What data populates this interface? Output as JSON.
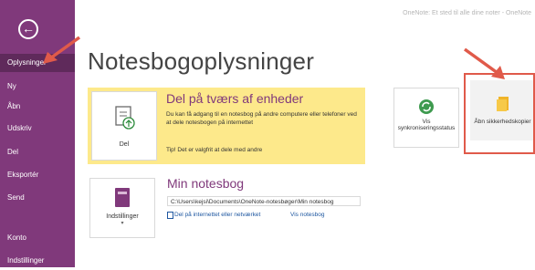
{
  "window": {
    "hint": "OneNote: Et sted til alle dine noter - OneNote"
  },
  "sidebar": {
    "back_icon": "back-arrow-icon",
    "items": [
      {
        "label": "Oplysninger",
        "active": true
      },
      {
        "label": "Ny"
      },
      {
        "label": "Åbn"
      },
      {
        "label": "Udskriv"
      },
      {
        "label": "Del"
      },
      {
        "label": "Eksportér"
      },
      {
        "label": "Send"
      },
      {
        "label": "Konto"
      },
      {
        "label": "Indstillinger"
      }
    ]
  },
  "main": {
    "title": "Notesbogoplysninger",
    "share": {
      "tile_label": "Del",
      "heading": "Del på tværs af enheder",
      "description": "Du kan få adgang til en notesbog på andre computere eller telefoner ved at dele notesbogen på internettet",
      "tip": "Tip! Det er valgfrit at dele med andre"
    },
    "notebook": {
      "settings_label": "Indstillinger",
      "settings_caret": "▾",
      "heading": "Min notesbog",
      "path": "C:\\Users\\kejsi\\Documents\\OneNote-notesbøger\\Min notesbog",
      "link_share": "Del på internettet eller netværket",
      "link_view": "Vis notesbog"
    },
    "sync_tile": {
      "line1": "Vis",
      "line2": "synkroniseringsstatus"
    },
    "backup_tile": {
      "label": "Åbn sikkerhedskopier"
    }
  },
  "colors": {
    "sidebar": "#80397b",
    "accent": "#80397b",
    "share_panel": "#fde98b",
    "annotation": "#e05a4a"
  }
}
